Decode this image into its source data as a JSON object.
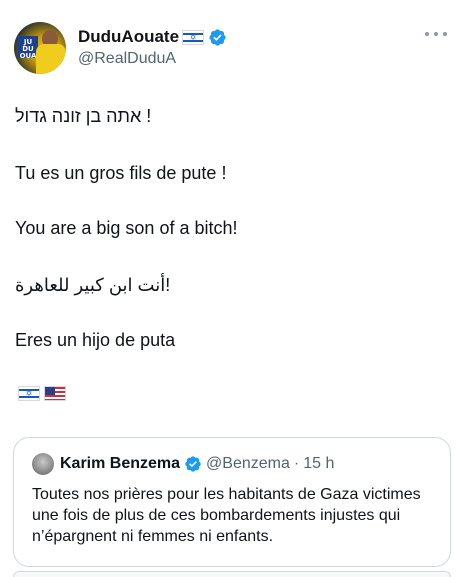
{
  "author": {
    "display_name": "DuduAouate",
    "handle": "@RealDuduA",
    "flag_icon": "israel-flag-icon",
    "verified_icon": "verified-badge-icon",
    "avatar_logo_text": "JUDU\nOUA"
  },
  "tweet": {
    "lines": [
      "! אתה בן זונה גדול",
      "Tu es un gros fils de pute !",
      "You are a big son of a bitch!",
      "!أنت ابن كبير للعاهرة",
      "Eres un hijo de puta"
    ],
    "trailing_flags": [
      "israel-flag-icon",
      "us-flag-icon"
    ]
  },
  "quoted_tweet": {
    "display_name": "Karim Benzema",
    "handle": "@Benzema",
    "separator": "·",
    "time": "15 h",
    "text": "Toutes nos prières pour les habitants de Gaza victimes une fois de plus de ces bombardements injustes qui n’épargnent ni femmes ni enfants."
  },
  "colors": {
    "text_primary": "#0f1419",
    "text_secondary": "#536471",
    "verified_blue": "#1d9bf0",
    "border": "#cfd9de"
  }
}
